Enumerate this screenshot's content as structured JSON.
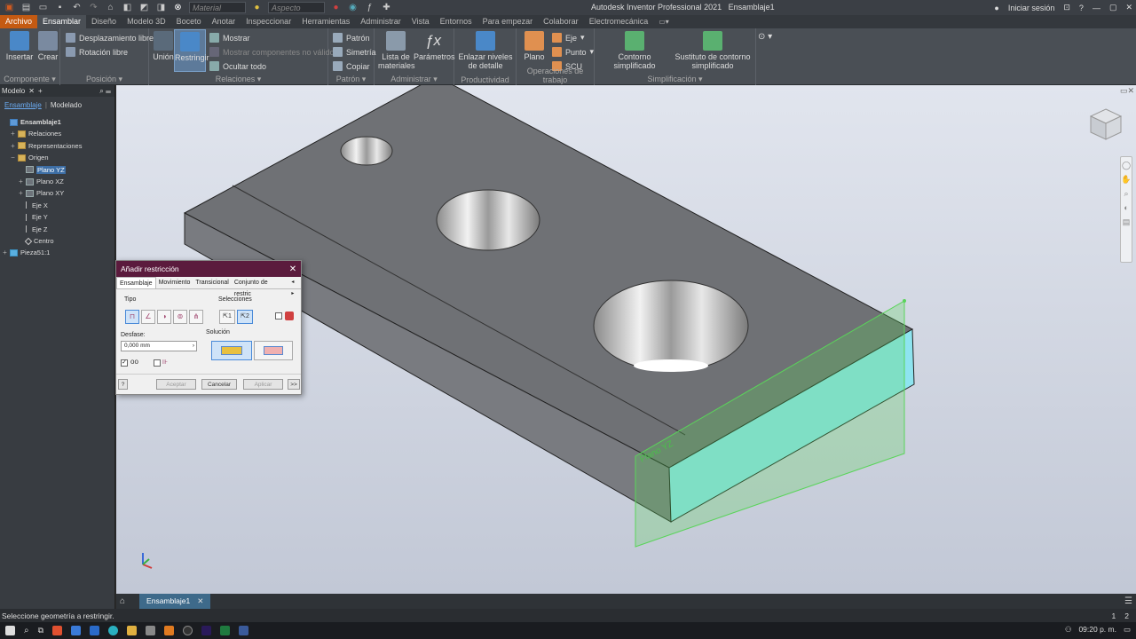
{
  "titlebar": {
    "material_placeholder": "Material",
    "aspect_placeholder": "Aspecto",
    "app_title": "Autodesk Inventor Professional 2021",
    "doc_title": "Ensamblaje1",
    "signin": "Iniciar sesión"
  },
  "tabs": [
    "Archivo",
    "Ensamblar",
    "Diseño",
    "Modelo 3D",
    "Boceto",
    "Anotar",
    "Inspeccionar",
    "Herramientas",
    "Administrar",
    "Vista",
    "Entornos",
    "Para empezar",
    "Colaborar",
    "Electromecánica"
  ],
  "ribbon": {
    "componente": {
      "insertar": "Insertar",
      "crear": "Crear",
      "label": "Componente"
    },
    "posicion": {
      "desplazamiento": "Desplazamiento libre",
      "rotacion": "Rotación libre",
      "label": "Posición"
    },
    "relaciones": {
      "union": "Unión",
      "restringir": "Restringir",
      "mostrar": "Mostrar",
      "mostrar_comp": "Mostrar componentes no válidos",
      "ocultar": "Ocultar todo",
      "label": "Relaciones"
    },
    "patron": {
      "patron": "Patrón",
      "simetria": "Simetría",
      "copiar": "Copiar",
      "label": "Patrón"
    },
    "administrar": {
      "lista": "Lista de materiales",
      "parametros": "Parámetros",
      "label": "Administrar"
    },
    "productividad": {
      "enlazar": "Enlazar niveles de detalle",
      "label": "Productividad"
    },
    "operaciones": {
      "plano": "Plano",
      "eje": "Eje",
      "punto": "Punto",
      "scu": "SCU",
      "label": "Operaciones de trabajo"
    },
    "simplificacion": {
      "contorno": "Contorno simplificado",
      "sustituto": "Sustituto de contorno simplificado",
      "label": "Simplificación"
    }
  },
  "browser": {
    "title": "Modelo",
    "sub1": "Ensamblaje",
    "sub2": "Modelado",
    "tree": [
      {
        "label": "Ensamblaje1",
        "indent": 0,
        "pm": "",
        "icon": "assm",
        "bold": true
      },
      {
        "label": "Relaciones",
        "indent": 1,
        "pm": "+",
        "icon": "folder"
      },
      {
        "label": "Representaciones",
        "indent": 1,
        "pm": "+",
        "icon": "folder"
      },
      {
        "label": "Origen",
        "indent": 1,
        "pm": "−",
        "icon": "folder"
      },
      {
        "label": "Plano YZ",
        "indent": 2,
        "pm": "",
        "icon": "plane",
        "sel": true
      },
      {
        "label": "Plano XZ",
        "indent": 2,
        "pm": "+",
        "icon": "plane"
      },
      {
        "label": "Plano XY",
        "indent": 2,
        "pm": "+",
        "icon": "plane"
      },
      {
        "label": "Eje X",
        "indent": 2,
        "pm": "",
        "icon": "axis"
      },
      {
        "label": "Eje Y",
        "indent": 2,
        "pm": "",
        "icon": "axis"
      },
      {
        "label": "Eje Z",
        "indent": 2,
        "pm": "",
        "icon": "axis"
      },
      {
        "label": "Centro",
        "indent": 2,
        "pm": "",
        "icon": "pt"
      },
      {
        "label": "Pieza51:1",
        "indent": 0,
        "pm": "+",
        "icon": "part"
      }
    ]
  },
  "dialog": {
    "title": "Añadir restricción",
    "tabs": [
      "Ensamblaje",
      "Movimiento",
      "Transicional",
      "Conjunto de restric"
    ],
    "tipo": "Tipo",
    "selecciones": "Selecciones",
    "desfase": "Desfase:",
    "desfase_value": "0,000 mm",
    "solucion": "Solución",
    "sel1": "1",
    "sel2": "2",
    "aceptar": "Aceptar",
    "cancelar": "Cancelar",
    "aplicar": "Aplicar",
    "more": ">>"
  },
  "viewport": {
    "plane_label": "Plano YZ"
  },
  "doc_tab": "Ensamblaje1",
  "status": {
    "message": "Seleccione geometría a restringir.",
    "page1": "1",
    "page2": "2"
  },
  "clock": "09:20 p. m.",
  "colors": {
    "archivo": "#c45a12",
    "dialog_title": "#5b1b3d",
    "accent_blue": "#3d6ea5",
    "plane_green": "#5ad45a"
  }
}
